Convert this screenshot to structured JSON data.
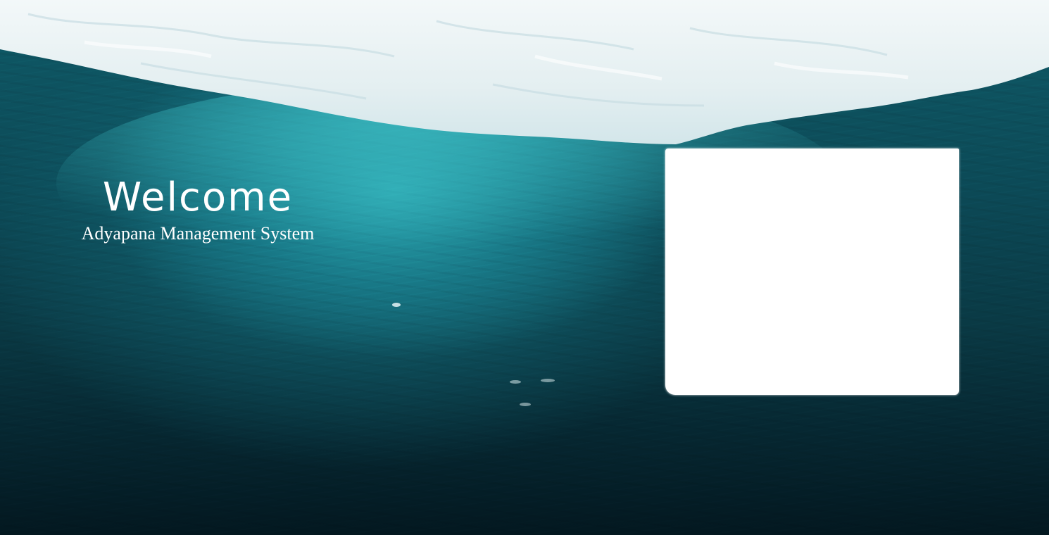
{
  "welcome": {
    "title": "Welcome",
    "subtitle": "Adyapana Management System"
  },
  "colors": {
    "ice": "#eef6f7",
    "sea_light": "#2aa9b4",
    "sea_deep": "#031820",
    "text": "#ffffff",
    "panel": "#ffffff"
  }
}
